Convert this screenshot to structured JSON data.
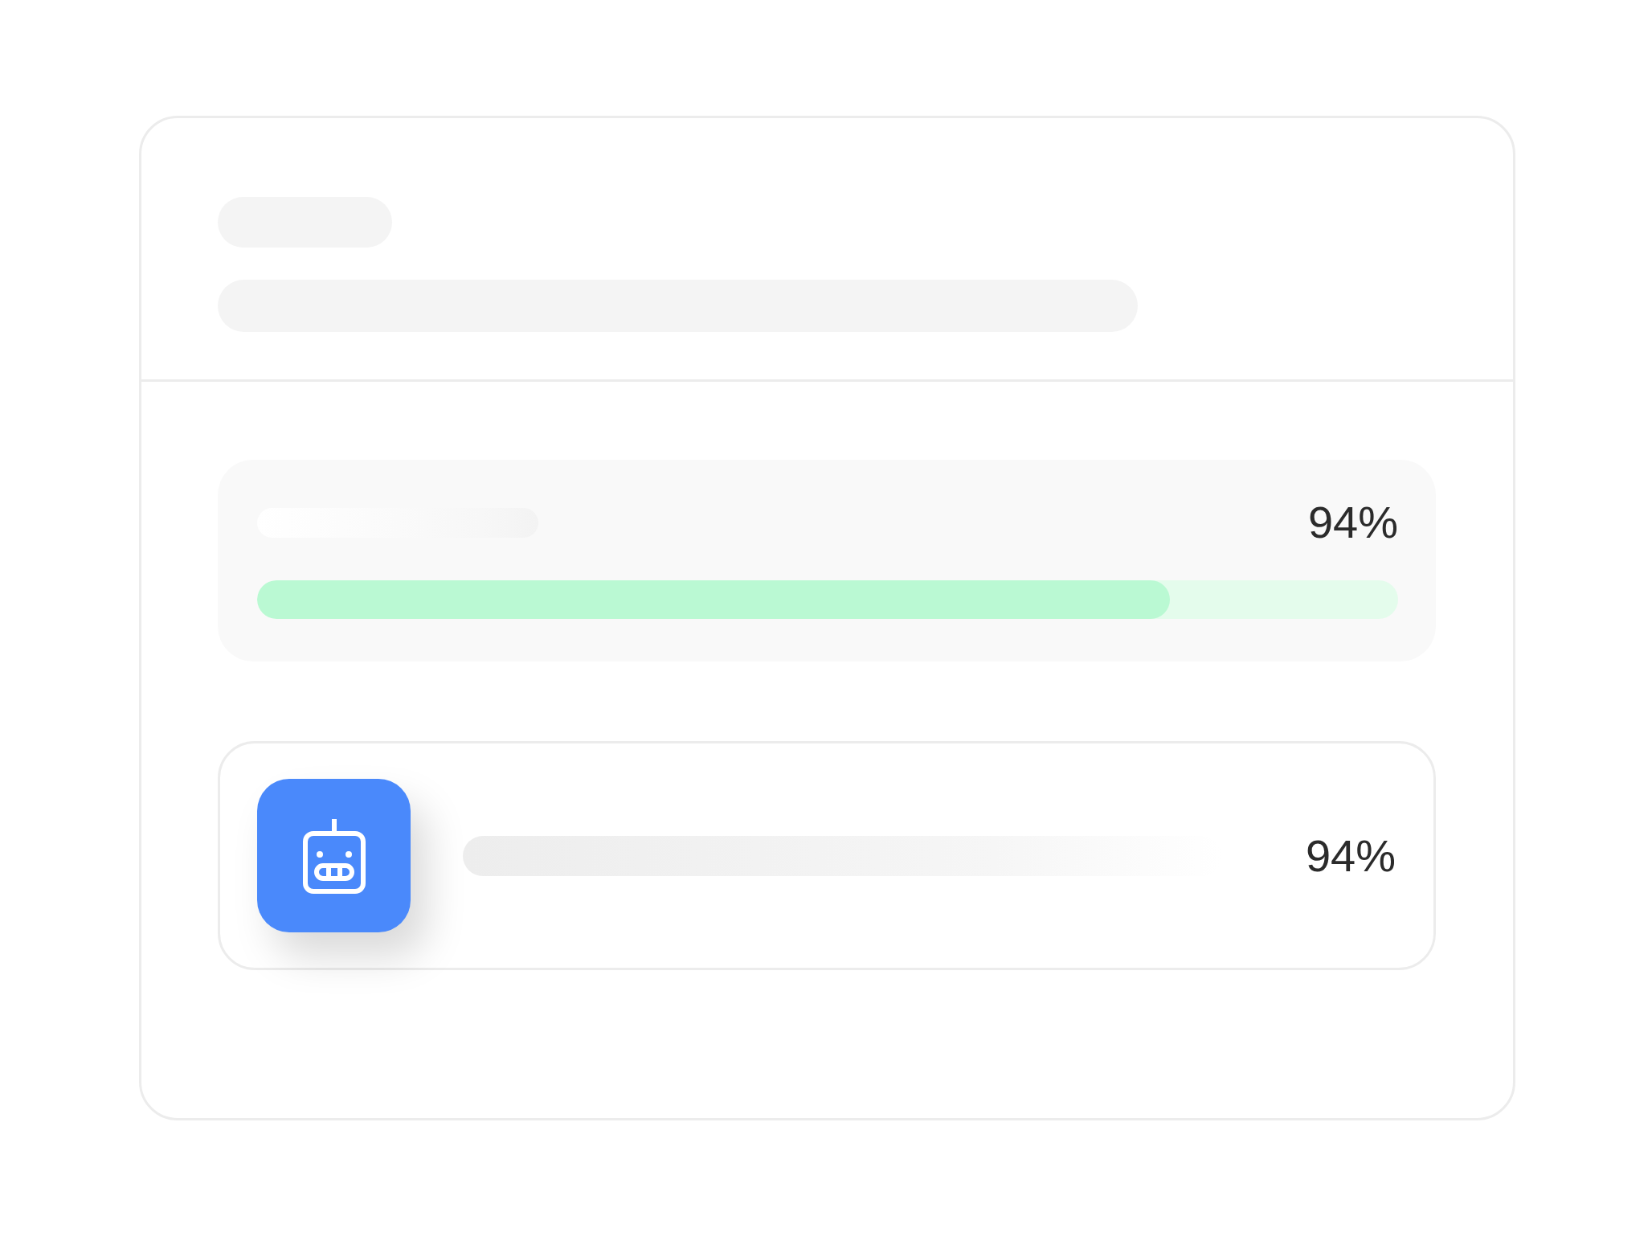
{
  "progress_panel": {
    "percent": "94%",
    "level": 0.8
  },
  "agent_row": {
    "percent": "94%"
  }
}
